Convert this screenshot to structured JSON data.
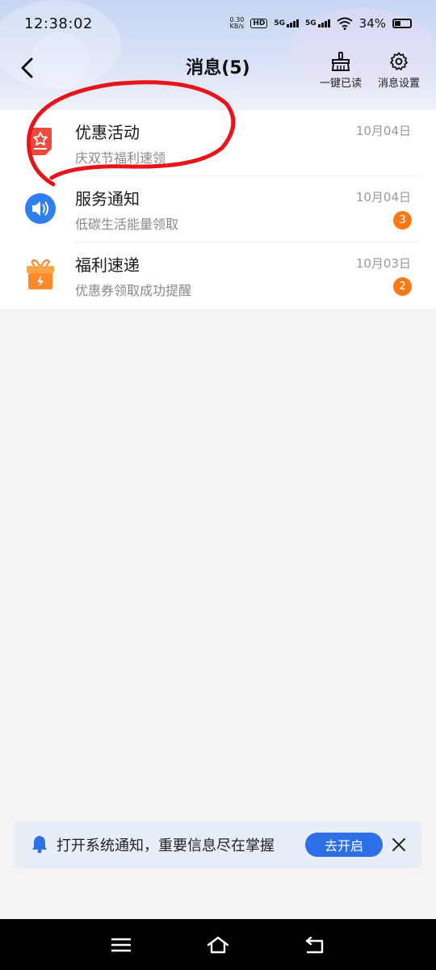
{
  "status_bar": {
    "time": "12:38:02",
    "net_speed_value": "0.30",
    "net_speed_unit": "KB/s",
    "hd_label": "HD",
    "signal1_label": "5G",
    "signal2_label": "5G",
    "battery_percent": "34%"
  },
  "header": {
    "title": "消息(5)",
    "mark_read_label": "一键已读",
    "settings_label": "消息设置"
  },
  "messages": [
    {
      "title": "优惠活动",
      "subtitle": "庆双节福利速领",
      "date": "10月04日",
      "badge": "",
      "icon": "coupon-star-icon",
      "icon_color": "#f0483c"
    },
    {
      "title": "服务通知",
      "subtitle": "低碳生活能量领取",
      "date": "10月04日",
      "badge": "3",
      "icon": "speaker-icon",
      "icon_color": "#2f7ff0"
    },
    {
      "title": "福利速递",
      "subtitle": "优惠券领取成功提醒",
      "date": "10月03日",
      "badge": "2",
      "icon": "gift-icon",
      "icon_color": "#ff8a2a"
    }
  ],
  "notify_banner": {
    "message": "打开系统通知，重要信息尽在掌握",
    "button_label": "去开启"
  },
  "colors": {
    "accent": "#2e6ee6",
    "badge": "#ff7a15",
    "annotation": "#e8141c"
  }
}
